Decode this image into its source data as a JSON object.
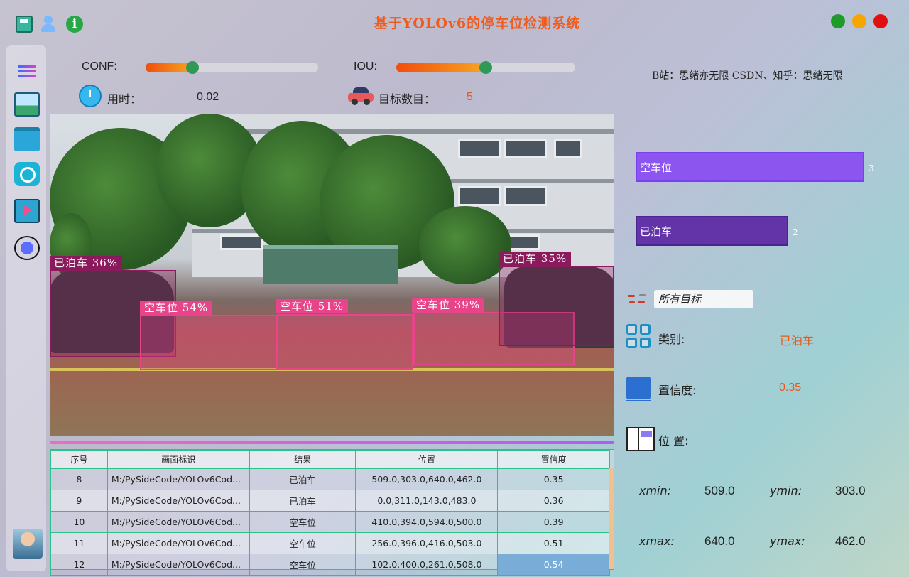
{
  "app": {
    "title": "基于YOLOv6的停车位检测系统",
    "credits": "B站：思绪亦无限  CSDN、知乎：思绪无限"
  },
  "controls": {
    "conf_label": "CONF:",
    "conf_value": 0.27,
    "iou_label": "IOU:",
    "iou_value": 0.5,
    "time_label": "用时：",
    "time_value": "0.02",
    "count_label": "目标数目：",
    "count_value": "5"
  },
  "detections": [
    {
      "label": "已泊车  36%",
      "color": "#8a1a5c"
    },
    {
      "label": "空车位  54%",
      "color": "#e8448a"
    },
    {
      "label": "空车位  51%",
      "color": "#e8448a"
    },
    {
      "label": "空车位  39%",
      "color": "#e8448a"
    },
    {
      "label": "已泊车  35%",
      "color": "#8a1a5c"
    }
  ],
  "table": {
    "headers": [
      "序号",
      "画面标识",
      "结果",
      "位置",
      "置信度"
    ],
    "rows": [
      [
        "8",
        "M:/PySideCode/YOLOv6Cod...",
        "已泊车",
        "509.0,303.0,640.0,462.0",
        "0.35"
      ],
      [
        "9",
        "M:/PySideCode/YOLOv6Cod...",
        "已泊车",
        "0.0,311.0,143.0,483.0",
        "0.36"
      ],
      [
        "10",
        "M:/PySideCode/YOLOv6Cod...",
        "空车位",
        "410.0,394.0,594.0,500.0",
        "0.39"
      ],
      [
        "11",
        "M:/PySideCode/YOLOv6Cod...",
        "空车位",
        "256.0,396.0,416.0,503.0",
        "0.51"
      ],
      [
        "12",
        "M:/PySideCode/YOLOv6Cod...",
        "空车位",
        "102.0,400.0,261.0,508.0",
        "0.54"
      ]
    ]
  },
  "stats": {
    "bars": [
      {
        "label": "空车位",
        "count": "3",
        "color": "#8c55f0",
        "border": "#7a3ff0"
      },
      {
        "label": "已泊车",
        "count": "2",
        "color": "#6234a8",
        "border": "#4b2490"
      }
    ]
  },
  "details": {
    "filter_value": "所有目标",
    "category_label": "类别:",
    "category_value": "已泊车",
    "confidence_label": "置信度:",
    "confidence_value": "0.35",
    "position_label": "位 置:",
    "xmin_label": "xmin:",
    "xmin_value": "509.0",
    "ymin_label": "ymin:",
    "ymin_value": "303.0",
    "xmax_label": "xmax:",
    "xmax_value": "640.0",
    "ymax_label": "ymax:",
    "ymax_value": "462.0"
  },
  "icons": {
    "save": "save-icon",
    "user": "user-icon",
    "info": "info-icon",
    "menu": "menu-icon",
    "image": "image-upload-icon",
    "folder": "folder-icon",
    "camera": "camera-icon",
    "video": "video-icon",
    "model": "model-icon",
    "timer": "timer-icon",
    "car": "car-icon",
    "filter": "filter-icon",
    "category": "category-icon",
    "confidence": "confidence-icon",
    "position": "position-icon"
  }
}
